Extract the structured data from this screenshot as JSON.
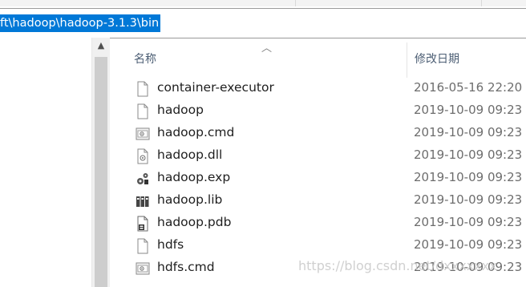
{
  "address": {
    "path": "ft\\hadoop\\hadoop-3.1.3\\bin"
  },
  "columns": {
    "name": "名称",
    "date": "修改日期"
  },
  "files": [
    {
      "name": "container-executor",
      "date": "2016-05-16 22:20",
      "icon": "blank-file-icon"
    },
    {
      "name": "hadoop",
      "date": "2019-10-09 09:23",
      "icon": "blank-file-icon"
    },
    {
      "name": "hadoop.cmd",
      "date": "2019-10-09 09:23",
      "icon": "cmd-file-icon"
    },
    {
      "name": "hadoop.dll",
      "date": "2019-10-09 09:23",
      "icon": "dll-file-icon"
    },
    {
      "name": "hadoop.exp",
      "date": "2019-10-09 09:23",
      "icon": "exp-file-icon"
    },
    {
      "name": "hadoop.lib",
      "date": "2019-10-09 09:23",
      "icon": "lib-file-icon"
    },
    {
      "name": "hadoop.pdb",
      "date": "2019-10-09 09:23",
      "icon": "pdb-file-icon"
    },
    {
      "name": "hdfs",
      "date": "2019-10-09 09:23",
      "icon": "blank-file-icon"
    },
    {
      "name": "hdfs.cmd",
      "date": "2019-10-09 09:23",
      "icon": "cmd-file-icon"
    }
  ],
  "watermark": "https://blog.csdn.net/dxxxxxxx",
  "colors": {
    "selection": "#0078d7",
    "header_text": "#4c5e74",
    "date_text": "#6d6d6d"
  }
}
